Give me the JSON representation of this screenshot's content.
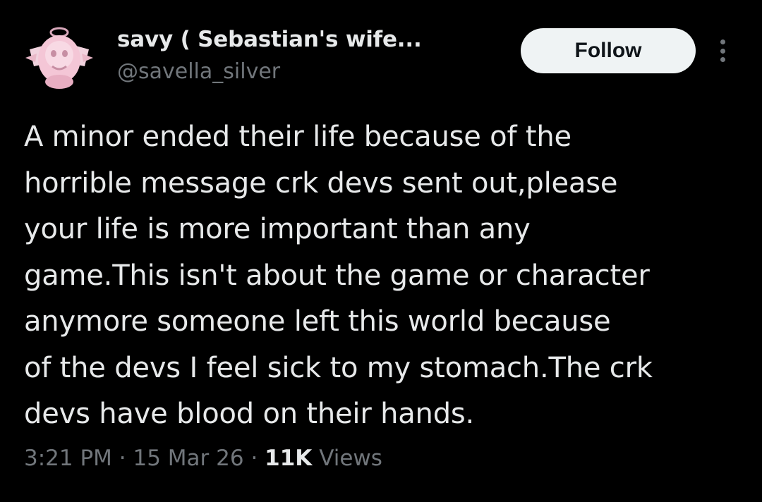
{
  "author": {
    "display_name": "savy ( Sebastian's wife...",
    "handle": "@savella_silver",
    "avatar_icon": "pink-cherub-avatar"
  },
  "actions": {
    "follow_label": "Follow",
    "more_icon": "more-vertical-icon"
  },
  "tweet": {
    "lines": [
      "A minor ended their life because of the",
      "horrible message crk devs sent out,please",
      "your life is more important than any",
      "game.This isn't about the game or character",
      "anymore someone left this world because",
      "of the devs I feel sick to my stomach.The crk",
      "devs have blood on their hands."
    ]
  },
  "meta": {
    "time": "3:21 PM",
    "separator": "·",
    "date": "15 Mar 26",
    "views_count": "11K",
    "views_label": "Views"
  },
  "colors": {
    "background": "#000000",
    "text_primary": "#e7e9ea",
    "text_secondary": "#71767b",
    "follow_bg": "#eff3f4",
    "follow_text": "#0f1419",
    "avatar_pink": "#f4c6d6"
  }
}
